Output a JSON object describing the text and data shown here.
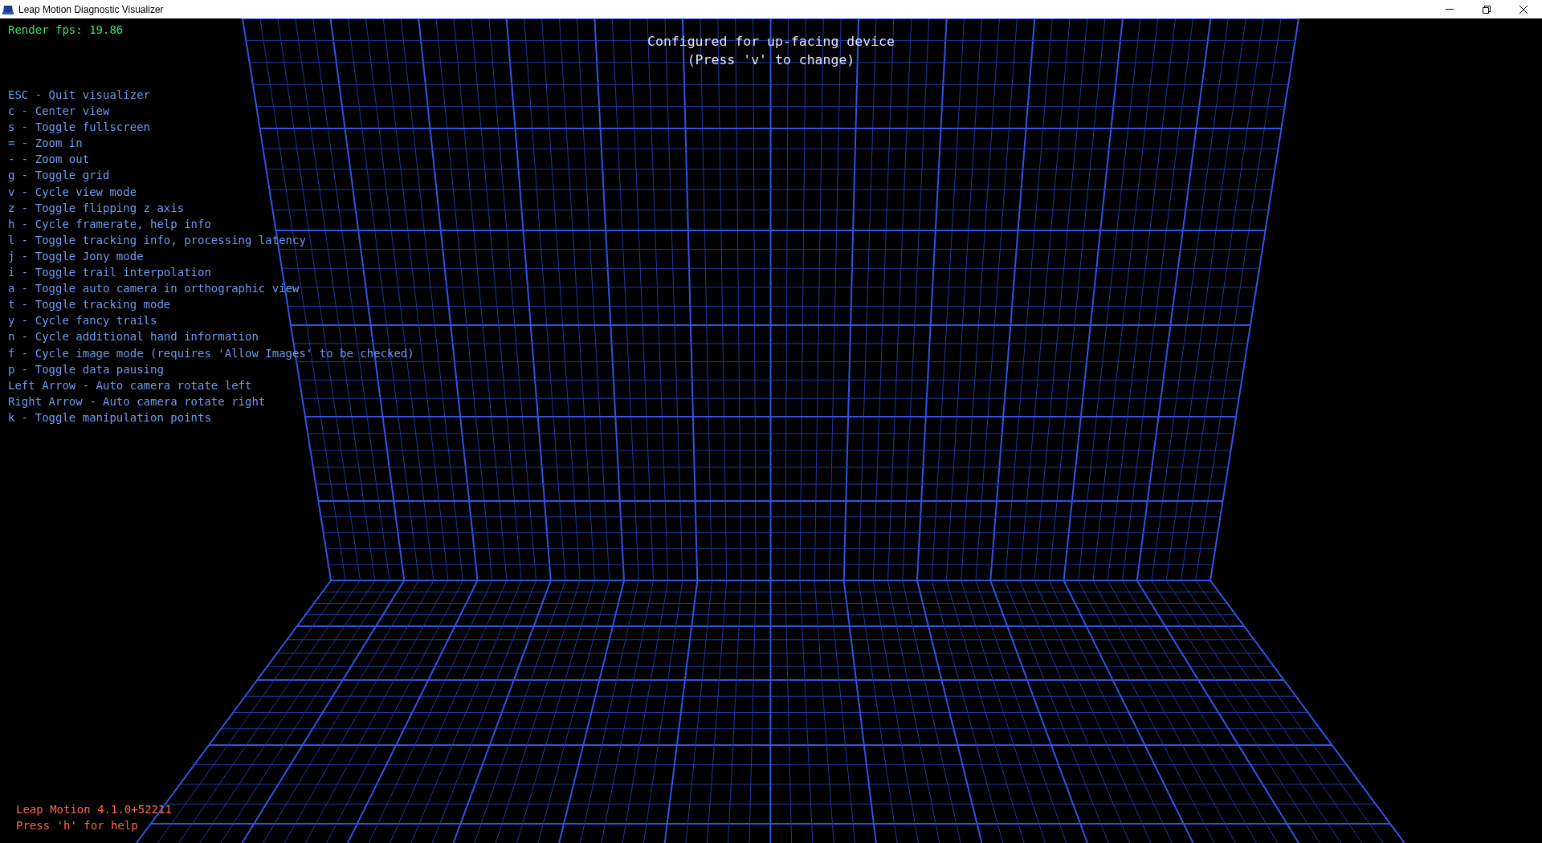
{
  "window": {
    "title": "Leap Motion Diagnostic Visualizer"
  },
  "render_fps": "Render fps: 19.86",
  "device_notice": [
    "Configured for up-facing device",
    "(Press 'v' to change)"
  ],
  "help_lines": [
    "ESC - Quit visualizer",
    "c - Center view",
    "s - Toggle fullscreen",
    "= - Zoom in",
    "- - Zoom out",
    "g - Toggle grid",
    "v - Cycle view mode",
    "z - Toggle flipping z axis",
    "h - Cycle framerate, help info",
    "l - Toggle tracking info, processing latency",
    "j - Toggle Jony mode",
    "i - Toggle trail interpolation",
    "a - Toggle auto camera in orthographic view",
    "t - Toggle tracking mode",
    "y - Cycle fancy trails",
    "n - Cycle additional hand information",
    "f - Cycle image mode (requires 'Allow Images' to be checked)",
    "p - Toggle data pausing",
    "Left Arrow - Auto camera rotate left",
    "Right Arrow - Auto camera rotate right",
    "k - Toggle manipulation points"
  ],
  "footer": [
    "Leap Motion 4.1.0+52211",
    "Press 'h' for help"
  ]
}
